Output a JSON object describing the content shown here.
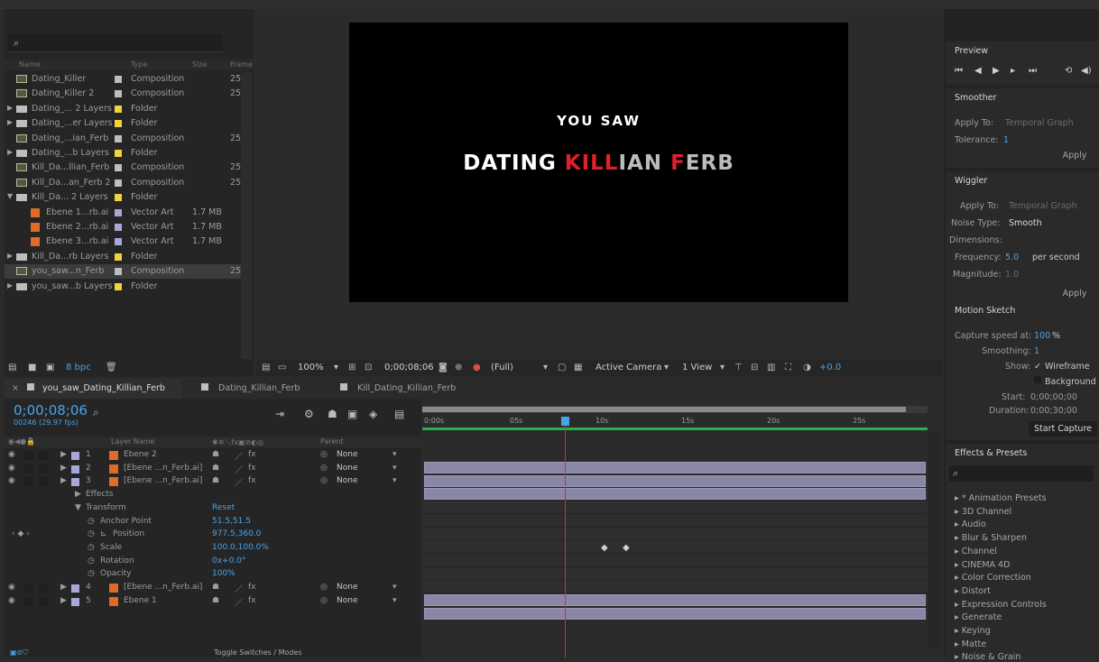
{
  "project": {
    "search_placeholder": "",
    "columns": {
      "name": "Name",
      "type": "Type",
      "size": "Size",
      "frame": "Frame"
    },
    "rows": [
      {
        "name": "Dating_Killer",
        "type": "Composition",
        "size": "",
        "frame": "25",
        "kind": "comp",
        "label_color": "#bdbdbd",
        "indent": 0,
        "twirl": ""
      },
      {
        "name": "Dating_Killer 2",
        "type": "Composition",
        "size": "",
        "frame": "25",
        "kind": "comp",
        "label_color": "#bdbdbd",
        "indent": 0,
        "twirl": ""
      },
      {
        "name": "Dating_... 2 Layers",
        "type": "Folder",
        "size": "",
        "frame": "",
        "kind": "folder",
        "label_color": "#f0d23c",
        "indent": 0,
        "twirl": "▶"
      },
      {
        "name": "Dating_...er Layers",
        "type": "Folder",
        "size": "",
        "frame": "",
        "kind": "folder",
        "label_color": "#f0d23c",
        "indent": 0,
        "twirl": "▶"
      },
      {
        "name": "Dating_...ian_Ferb",
        "type": "Composition",
        "size": "",
        "frame": "25",
        "kind": "comp",
        "label_color": "#bdbdbd",
        "indent": 0,
        "twirl": ""
      },
      {
        "name": "Dating_...b Layers",
        "type": "Folder",
        "size": "",
        "frame": "",
        "kind": "folder",
        "label_color": "#f0d23c",
        "indent": 0,
        "twirl": "▶"
      },
      {
        "name": "Kill_Da...llian_Ferb",
        "type": "Composition",
        "size": "",
        "frame": "25",
        "kind": "comp",
        "label_color": "#bdbdbd",
        "indent": 0,
        "twirl": ""
      },
      {
        "name": "Kill_Da...an_Ferb 2",
        "type": "Composition",
        "size": "",
        "frame": "25",
        "kind": "comp",
        "label_color": "#bdbdbd",
        "indent": 0,
        "twirl": ""
      },
      {
        "name": "Kill_Da... 2 Layers",
        "type": "Folder",
        "size": "",
        "frame": "",
        "kind": "folder",
        "label_color": "#f0d23c",
        "indent": 0,
        "twirl": "▼"
      },
      {
        "name": "Ebene 1...rb.ai",
        "type": "Vector Art",
        "size": "1.7 MB",
        "frame": "",
        "kind": "ai",
        "label_color": "#a8a8d8",
        "indent": 1,
        "twirl": ""
      },
      {
        "name": "Ebene 2...rb.ai",
        "type": "Vector Art",
        "size": "1.7 MB",
        "frame": "",
        "kind": "ai",
        "label_color": "#a8a8d8",
        "indent": 1,
        "twirl": ""
      },
      {
        "name": "Ebene 3...rb.ai",
        "type": "Vector Art",
        "size": "1.7 MB",
        "frame": "",
        "kind": "ai",
        "label_color": "#a8a8d8",
        "indent": 1,
        "twirl": ""
      },
      {
        "name": "Kill_Da...rb Layers",
        "type": "Folder",
        "size": "",
        "frame": "",
        "kind": "folder",
        "label_color": "#f0d23c",
        "indent": 0,
        "twirl": "▶"
      },
      {
        "name": "you_saw...n_Ferb",
        "type": "Composition",
        "size": "",
        "frame": "25",
        "kind": "comp",
        "label_color": "#bdbdbd",
        "indent": 0,
        "twirl": "",
        "selected": true
      },
      {
        "name": "you_saw...b Layers",
        "type": "Folder",
        "size": "",
        "frame": "",
        "kind": "folder",
        "label_color": "#f0d23c",
        "indent": 0,
        "twirl": "▶"
      }
    ],
    "footer_bpc": "8 bpc"
  },
  "viewer": {
    "line1": "YOU SAW",
    "line2_a": "DATING ",
    "line2_b": "KILL",
    "line2_c": "IAN ",
    "line2_d": "F",
    "line2_e": "ERB",
    "zoom": "100%",
    "timecode": "0;00;08;06",
    "resolution": "(Full)",
    "camera": "Active Camera",
    "views": "1 View",
    "exposure": "+0.0"
  },
  "preview": {
    "title": "Preview"
  },
  "smoother": {
    "title": "Smoother",
    "apply_to_label": "Apply To:",
    "apply_to_value": "Temporal Graph",
    "tolerance_label": "Tolerance:",
    "tolerance_value": "1",
    "apply": "Apply"
  },
  "wiggler": {
    "title": "Wiggler",
    "apply_to_label": "Apply To:",
    "apply_to_value": "Temporal Graph",
    "noise_label": "Noise Type:",
    "noise_value": "Smooth",
    "dimensions_label": "Dimensions:",
    "frequency_label": "Frequency:",
    "frequency_value": "5.0",
    "frequency_unit": "per second",
    "magnitude_label": "Magnitude:",
    "magnitude_value": "1.0",
    "apply": "Apply"
  },
  "motion_sketch": {
    "title": "Motion Sketch",
    "capture_label": "Capture speed at:",
    "capture_value": "100",
    "capture_unit": "%",
    "smoothing_label": "Smoothing:",
    "smoothing_value": "1",
    "show_label": "Show:",
    "wireframe": "Wireframe",
    "background": "Background",
    "start_label": "Start:",
    "start_value": "0;00;00;00",
    "duration_label": "Duration:",
    "duration_value": "0;00;30;00",
    "start_capture": "Start Capture"
  },
  "effects": {
    "title": "Effects & Presets",
    "items": [
      "* Animation Presets",
      "3D Channel",
      "Audio",
      "Blur & Sharpen",
      "Channel",
      "CINEMA 4D",
      "Color Correction",
      "Distort",
      "Expression Controls",
      "Generate",
      "Keying",
      "Matte",
      "Noise & Grain"
    ]
  },
  "timeline": {
    "tabs": [
      "you_saw_Dating_Killian_Ferb",
      "Dating_Killian_Ferb",
      "Kill_Dating_Killian_Ferb"
    ],
    "timecode": "0;00;08;06",
    "fps": "00246 (29.97 fps)",
    "col_layer_name": "Layer Name",
    "col_parent": "Parent",
    "ruler": [
      "0:00s",
      "05s",
      "10s",
      "15s",
      "20s",
      "25s"
    ],
    "layers": [
      {
        "num": "1",
        "name": "Ebene 2",
        "parent": "None"
      },
      {
        "num": "2",
        "name": "[Ebene ...n_Ferb.ai]",
        "parent": "None"
      },
      {
        "num": "3",
        "name": "[Ebene ...n_Ferb.ai]",
        "parent": "None"
      }
    ],
    "props": {
      "effects": "Effects",
      "transform": "Transform",
      "reset": "Reset",
      "anchor_label": "Anchor Point",
      "anchor_value": "51.5,51.5",
      "position_label": "Position",
      "position_value": "977.5,360.0",
      "scale_label": "Scale",
      "scale_value": "100.0,100.0%",
      "rotation_label": "Rotation",
      "rotation_value": "0x+0.0°",
      "opacity_label": "Opacity",
      "opacity_value": "100%"
    },
    "layers2": [
      {
        "num": "4",
        "name": "[Ebene ...n_Ferb.ai]",
        "parent": "None"
      },
      {
        "num": "5",
        "name": "Ebene 1",
        "parent": "None"
      }
    ],
    "toggle": "Toggle Switches / Modes"
  }
}
